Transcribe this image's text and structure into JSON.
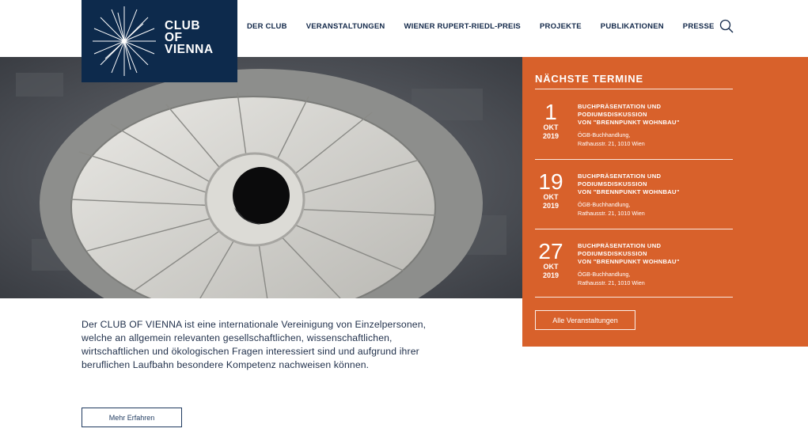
{
  "logo": {
    "line1": "CLUB",
    "line2": "OF",
    "line3": "VIENNA",
    "bg_color": "#0d2a4c"
  },
  "nav": {
    "items": [
      {
        "label": "DER CLUB"
      },
      {
        "label": "VERANSTALTUNGEN"
      },
      {
        "label": "WIENER RUPERT-RIEDL-PREIS"
      },
      {
        "label": "PROJEKTE"
      },
      {
        "label": "PUBLIKATIONEN"
      },
      {
        "label": "PRESSE"
      }
    ],
    "search_icon": "search-icon"
  },
  "events": {
    "title": "NÄCHSTE TERMINE",
    "accent_color": "#d8612b",
    "items": [
      {
        "day": "1",
        "month": "OKT",
        "year": "2019",
        "title_line1": "BUCHPRÄSENTATION UND",
        "title_line2": "PODIUMSDISKUSSION",
        "title_line3": "VON \"BRENNPUNKT WOHNBAU\"",
        "loc_line1": "ÖGB-Buchhandlung,",
        "loc_line2": "Rathausstr. 21, 1010 Wien"
      },
      {
        "day": "19",
        "month": "OKT",
        "year": "2019",
        "title_line1": "BUCHPRÄSENTATION UND",
        "title_line2": "PODIUMSDISKUSSION",
        "title_line3": "VON \"BRENNPUNKT WOHNBAU\"",
        "loc_line1": "ÖGB-Buchhandlung,",
        "loc_line2": "Rathausstr. 21, 1010 Wien"
      },
      {
        "day": "27",
        "month": "OKT",
        "year": "2019",
        "title_line1": "BUCHPRÄSENTATION UND",
        "title_line2": "PODIUMSDISKUSSION",
        "title_line3": "VON \"BRENNPUNKT WOHNBAU\"",
        "loc_line1": "ÖGB-Buchhandlung,",
        "loc_line2": "Rathausstr. 21, 1010 Wien"
      }
    ],
    "all_button": "Alle Veranstaltungen"
  },
  "intro": {
    "text": "Der CLUB OF VIENNA ist eine internationale Vereinigung von Einzelpersonen, welche an allgemein relevanten gesellschaftlichen, wissenschaftlichen, wirtschaftlichen und ökologischen Fragen interessiert sind und aufgrund ihrer beruflichen Laufbahn besondere Kompetenz nachweisen können.",
    "more_button": "Mehr Erfahren"
  }
}
